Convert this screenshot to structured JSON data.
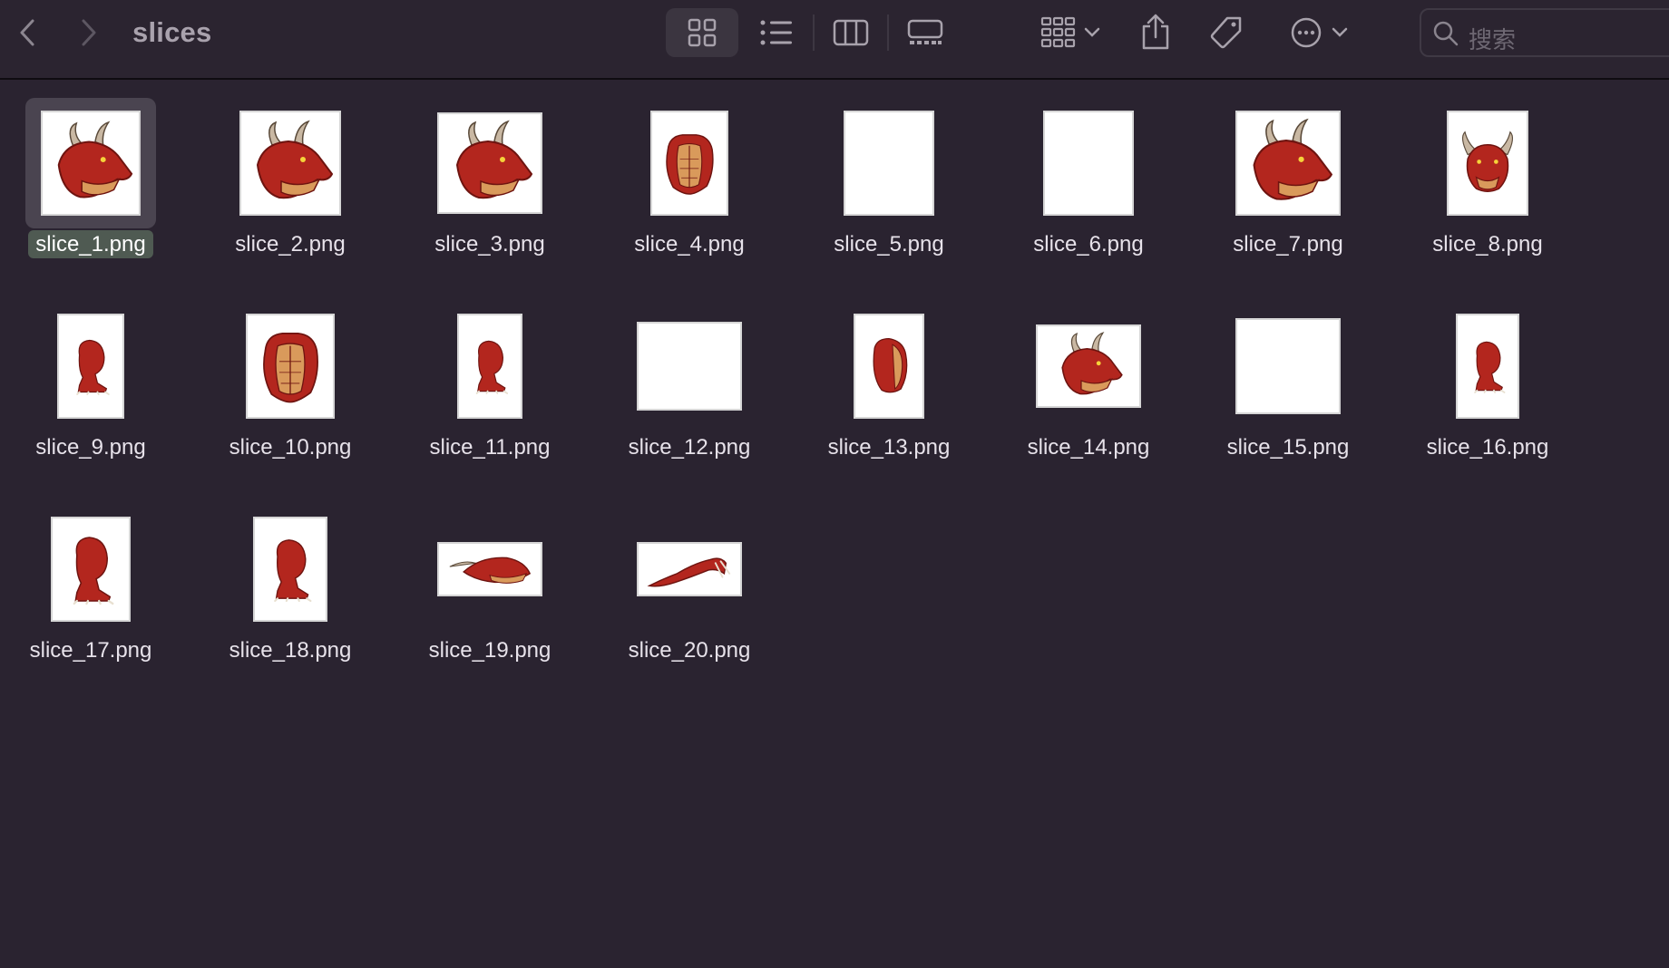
{
  "window": {
    "title": "slices"
  },
  "toolbar": {
    "back_icon": "chevron-left-icon",
    "forward_icon": "chevron-right-icon",
    "view_modes": [
      "icon-grid-view",
      "list-view",
      "column-view",
      "gallery-view"
    ],
    "active_view": "icon-grid-view",
    "group_icon": "group-by-icon",
    "share_icon": "share-icon",
    "tag_icon": "tag-icon",
    "more_icon": "ellipsis-circle-icon"
  },
  "search": {
    "placeholder": "搜索"
  },
  "files": [
    {
      "name": "slice_1.png",
      "thumb": "dragon-head",
      "selected": true
    },
    {
      "name": "slice_2.png",
      "thumb": "dragon-head"
    },
    {
      "name": "slice_3.png",
      "thumb": "dragon-head"
    },
    {
      "name": "slice_4.png",
      "thumb": "torso"
    },
    {
      "name": "slice_5.png",
      "thumb": "blank"
    },
    {
      "name": "slice_6.png",
      "thumb": "blank"
    },
    {
      "name": "slice_7.png",
      "thumb": "dragon-head"
    },
    {
      "name": "slice_8.png",
      "thumb": "dragon-head-front"
    },
    {
      "name": "slice_9.png",
      "thumb": "leg"
    },
    {
      "name": "slice_10.png",
      "thumb": "torso"
    },
    {
      "name": "slice_11.png",
      "thumb": "leg"
    },
    {
      "name": "slice_12.png",
      "thumb": "blank"
    },
    {
      "name": "slice_13.png",
      "thumb": "torso-side"
    },
    {
      "name": "slice_14.png",
      "thumb": "dragon-head"
    },
    {
      "name": "slice_15.png",
      "thumb": "blank"
    },
    {
      "name": "slice_16.png",
      "thumb": "leg"
    },
    {
      "name": "slice_17.png",
      "thumb": "leg"
    },
    {
      "name": "slice_18.png",
      "thumb": "leg"
    },
    {
      "name": "slice_19.png",
      "thumb": "dragon-head-flat"
    },
    {
      "name": "slice_20.png",
      "thumb": "arm"
    }
  ]
}
